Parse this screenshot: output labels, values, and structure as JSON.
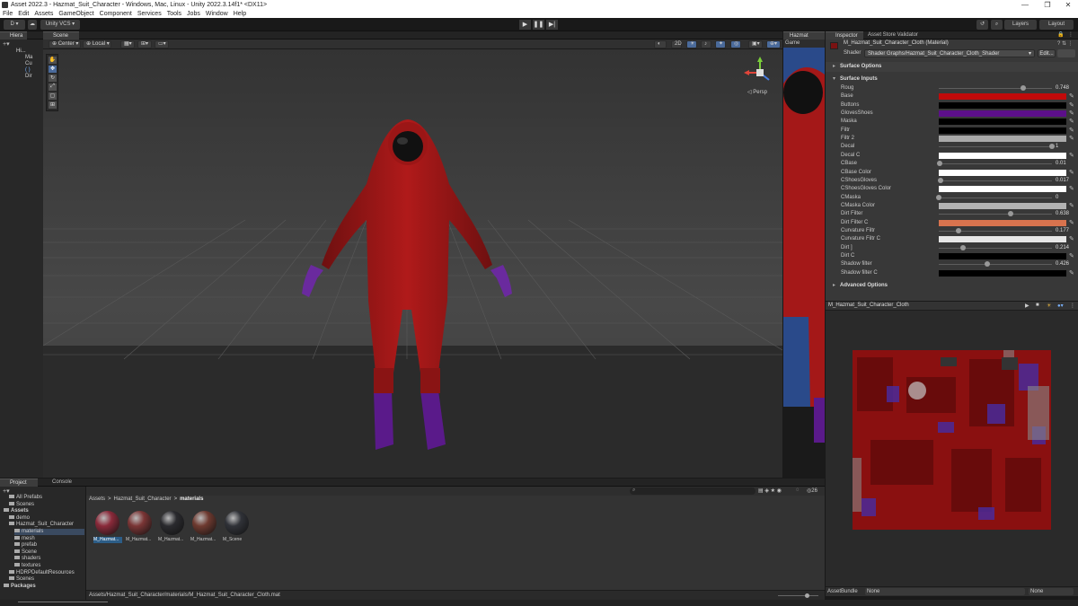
{
  "window": {
    "title": "Asset 2022.3 - Hazmat_Suit_Character - Windows, Mac, Linux - Unity 2022.3.14f1* <DX11>",
    "min": "—",
    "max": "❐",
    "close": "✕"
  },
  "menu": [
    "File",
    "Edit",
    "Assets",
    "GameObject",
    "Component",
    "Services",
    "Tools",
    "Jobs",
    "Window",
    "Help"
  ],
  "toolbar": {
    "account": "D ▾",
    "vcs": "Unity VCS ▾",
    "layers": "Layers",
    "layout": "Layout"
  },
  "hierarchy": {
    "tab": "Hiera",
    "items": [
      "Hi...",
      "Ma",
      "Cu",
      "( )",
      "Dir"
    ]
  },
  "scene": {
    "tab": "Scene",
    "pivot": "Center",
    "space": "Local",
    "persp": "◁ Persp"
  },
  "game": {
    "tab": "Hazmat",
    "subtab": "Game"
  },
  "inspector": {
    "tab": "Inspector",
    "tab2": "Asset Store Validator",
    "material_name": "M_Hazmat_Suit_Character_Cloth (Material)",
    "shader_label": "Shader",
    "shader_value": "Shader Graphs/Hazmat_Suit_Character_Cloth_Shader",
    "edit_label": "Edit...",
    "surface_options": "Surface Options",
    "surface_inputs": "Surface Inputs",
    "advanced_options": "Advanced Options",
    "properties": [
      {
        "label": "Roug",
        "kind": "slider",
        "value": 0.748,
        "display": "0.748"
      },
      {
        "label": "Base",
        "kind": "color",
        "color": "#c10a0a"
      },
      {
        "label": "Buttons",
        "kind": "color",
        "color": "#000000"
      },
      {
        "label": "GlovesShoes",
        "kind": "color",
        "color": "#5c0f8a"
      },
      {
        "label": "Maska",
        "kind": "color",
        "color": "#000000"
      },
      {
        "label": "Filtr",
        "kind": "color",
        "color": "#000000"
      },
      {
        "label": "Filtr 2",
        "kind": "color",
        "color": "#a9a9a9"
      },
      {
        "label": "Decal",
        "kind": "slider",
        "value": 1,
        "display": "1"
      },
      {
        "label": "Decal C",
        "kind": "color",
        "color": "#ffffff"
      },
      {
        "label": "CBase",
        "kind": "slider",
        "value": 0.01,
        "display": "0.01"
      },
      {
        "label": "CBase Color",
        "kind": "color",
        "color": "#ffffff"
      },
      {
        "label": "CShoesGloves",
        "kind": "slider",
        "value": 0.017,
        "display": "0.017"
      },
      {
        "label": "CShoesGloves Color",
        "kind": "color",
        "color": "#ffffff"
      },
      {
        "label": "CMaska",
        "kind": "slider",
        "value": 0,
        "display": "0"
      },
      {
        "label": "CMaska Color",
        "kind": "color",
        "color": "#b3b3b3"
      },
      {
        "label": "Dirt Filter",
        "kind": "slider",
        "value": 0.638,
        "display": "0.638"
      },
      {
        "label": "Dirt Filter C",
        "kind": "color",
        "color": "#d8734e"
      },
      {
        "label": "Curvature Filtr",
        "kind": "slider",
        "value": 0.177,
        "display": "0.177"
      },
      {
        "label": "Curvature Filtr C",
        "kind": "color",
        "color": "#e6e6e6"
      },
      {
        "label": "Dirt ]",
        "kind": "slider",
        "value": 0.214,
        "display": "0.214"
      },
      {
        "label": "Dirt C",
        "kind": "color",
        "color": "#000000"
      },
      {
        "label": "Shadow filter",
        "kind": "slider",
        "value": 0.426,
        "display": "0.426"
      },
      {
        "label": "Shadow filter C",
        "kind": "color",
        "color": "#000000"
      }
    ]
  },
  "preview": {
    "title": "M_Hazmat_Suit_Character_Cloth"
  },
  "assetbundle": {
    "label": "AssetBundle",
    "value": "None",
    "variant": "None"
  },
  "project": {
    "tab": "Project",
    "tab2": "Console",
    "breadcrumb": [
      "Assets",
      "Hazmat_Suit_Character",
      "materials"
    ],
    "tree": [
      {
        "label": "All Prefabs",
        "indent": 1
      },
      {
        "label": "Scenes",
        "indent": 1
      },
      {
        "label": "Assets",
        "indent": 0,
        "bold": true
      },
      {
        "label": "demo",
        "indent": 1
      },
      {
        "label": "Hazmat_Suit_Character",
        "indent": 1
      },
      {
        "label": "materials",
        "indent": 2,
        "selected": true
      },
      {
        "label": "mesh",
        "indent": 2
      },
      {
        "label": "prefab",
        "indent": 2
      },
      {
        "label": "Scene",
        "indent": 2
      },
      {
        "label": "shaders",
        "indent": 2
      },
      {
        "label": "textures",
        "indent": 2
      },
      {
        "label": "HDRPDefaultResources",
        "indent": 1
      },
      {
        "label": "Scenes",
        "indent": 1
      },
      {
        "label": "Packages",
        "indent": 0,
        "bold": true
      }
    ],
    "assets": [
      {
        "name": "M_Hazmat...",
        "color": "#8a2a3a",
        "selected": true
      },
      {
        "name": "M_Hazmat...",
        "color": "#7a3535"
      },
      {
        "name": "M_Hazmat...",
        "color": "#2a2a2e"
      },
      {
        "name": "M_Hazmat...",
        "color": "#6e3a30"
      },
      {
        "name": "M_Scene",
        "color": "#303238"
      }
    ],
    "count": "26",
    "path": "Assets/Hazmat_Suit_Character/materials/M_Hazmat_Suit_Character_Cloth.mat"
  }
}
